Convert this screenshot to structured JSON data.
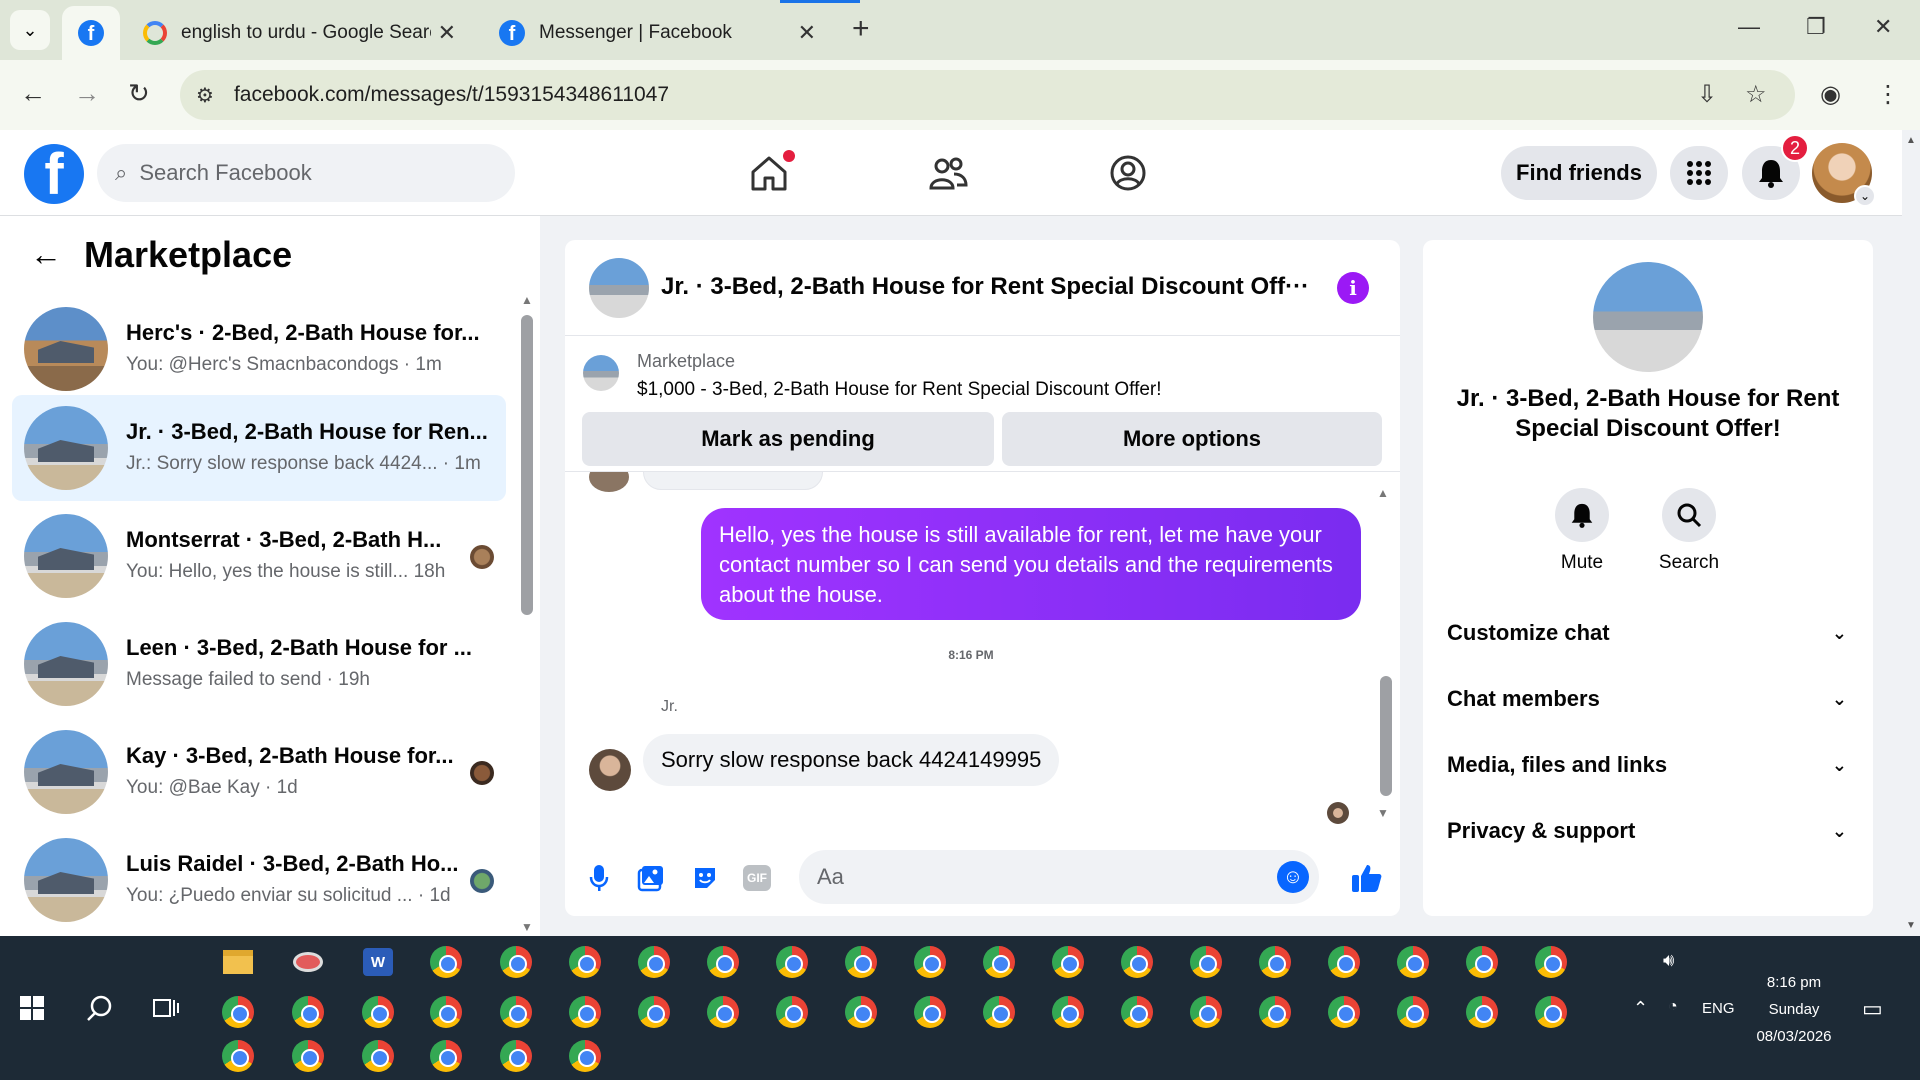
{
  "browser": {
    "tabs": [
      {
        "title": "",
        "icon": "facebook-icon"
      },
      {
        "title": "english to urdu - Google Search",
        "icon": "google-icon"
      },
      {
        "title": "Messenger | Facebook",
        "icon": "facebook-icon"
      }
    ],
    "url": "facebook.com/messages/t/1593154348611047"
  },
  "fb_header": {
    "search_placeholder": "Search Facebook",
    "find_friends": "Find friends",
    "notification_count": "2"
  },
  "sidebar": {
    "title": "Marketplace",
    "conversations": [
      {
        "name": "Herc's · 2-Bed, 2-Bath House for...",
        "preview": "You: @Herc's Smacnbacondogs · 1m"
      },
      {
        "name": "Jr. · 3-Bed, 2-Bath House for Ren...",
        "preview": "Jr.: Sorry slow response back 4424... · 1m"
      },
      {
        "name": "Montserrat · 3-Bed, 2-Bath H...",
        "preview": "You: Hello, yes the house is still...  18h"
      },
      {
        "name": "Leen · 3-Bed, 2-Bath House for ...",
        "preview": "Message failed to send · 19h"
      },
      {
        "name": "Kay · 3-Bed, 2-Bath House for...",
        "preview": "You: @Bae Kay · 1d"
      },
      {
        "name": "Luis Raidel · 3-Bed, 2-Bath Ho...",
        "preview": "You: ¿Puedo enviar su solicitud ...  · 1d"
      }
    ]
  },
  "chat": {
    "header_name": "Jr. · 3-Bed, 2-Bath House for Rent Special Discount Off···",
    "marketplace_label": "Marketplace",
    "marketplace_desc": "$1,000 - 3-Bed, 2-Bath House for Rent Special Discount Offer!",
    "mark_pending": "Mark as pending",
    "more_options": "More options",
    "sent_message": "Hello, yes the house is still available for rent, let me have your contact number so I can send you details and the requirements about the house.",
    "timestamp": "8:16 PM",
    "sender": "Jr.",
    "received_message": "Sorry slow response back 4424149995",
    "composer_placeholder": "Aa",
    "gif_label": "GIF"
  },
  "right_panel": {
    "name": "Jr. · 3-Bed, 2-Bath House for Rent Special Discount Offer!",
    "mute": "Mute",
    "search": "Search",
    "sections": [
      "Customize chat",
      "Chat members",
      "Media, files and links",
      "Privacy & support"
    ]
  },
  "taskbar": {
    "time": "8:16 pm",
    "day": "Sunday",
    "date": "08/03/2026",
    "lang": "ENG"
  },
  "colors": {
    "fb_blue": "#1877f2",
    "messenger_purple": "#9b19f5",
    "selected_row": "#e7f3ff",
    "chrome_frame": "#dfe6d8"
  }
}
